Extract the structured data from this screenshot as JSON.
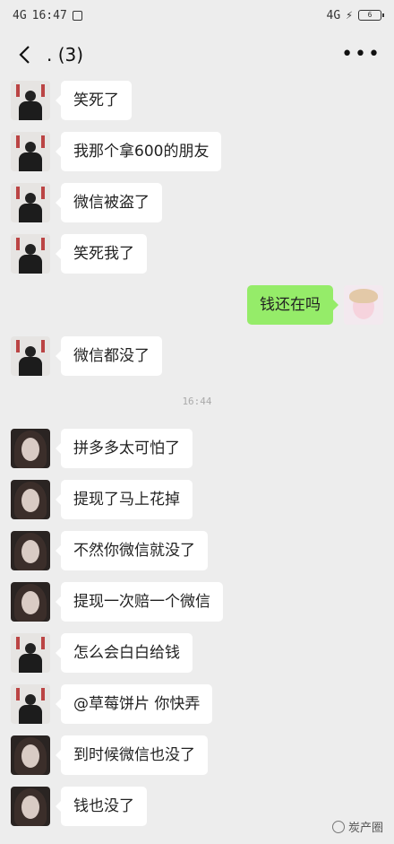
{
  "status_bar": {
    "network": "4G",
    "time": "16:47",
    "network_right": "4G",
    "battery_level": "6"
  },
  "header": {
    "title": ". (3)",
    "more": "•••"
  },
  "messages_top": [
    {
      "side": "left",
      "avatar": "man",
      "text": "笑死了"
    },
    {
      "side": "left",
      "avatar": "man",
      "text": "我那个拿600的朋友"
    },
    {
      "side": "left",
      "avatar": "man",
      "text": "微信被盗了"
    },
    {
      "side": "left",
      "avatar": "man",
      "text": "笑死我了"
    },
    {
      "side": "right",
      "avatar": "me",
      "text": "钱还在吗"
    },
    {
      "side": "left",
      "avatar": "man",
      "text": "微信都没了"
    }
  ],
  "timestamp": "16:44",
  "messages_bottom": [
    {
      "side": "left",
      "avatar": "girl",
      "text": "拼多多太可怕了"
    },
    {
      "side": "left",
      "avatar": "girl",
      "text": "提现了马上花掉"
    },
    {
      "side": "left",
      "avatar": "girl",
      "text": "不然你微信就没了"
    },
    {
      "side": "left",
      "avatar": "girl",
      "text": "提现一次赔一个微信"
    },
    {
      "side": "left",
      "avatar": "man",
      "text": "怎么会白白给钱"
    },
    {
      "side": "left",
      "avatar": "man",
      "text": "@草莓饼片 你快弄"
    },
    {
      "side": "left",
      "avatar": "girl",
      "text": "到时候微信也没了"
    },
    {
      "side": "left",
      "avatar": "girl",
      "text": "钱也没了"
    }
  ],
  "watermark": "炭产圈"
}
